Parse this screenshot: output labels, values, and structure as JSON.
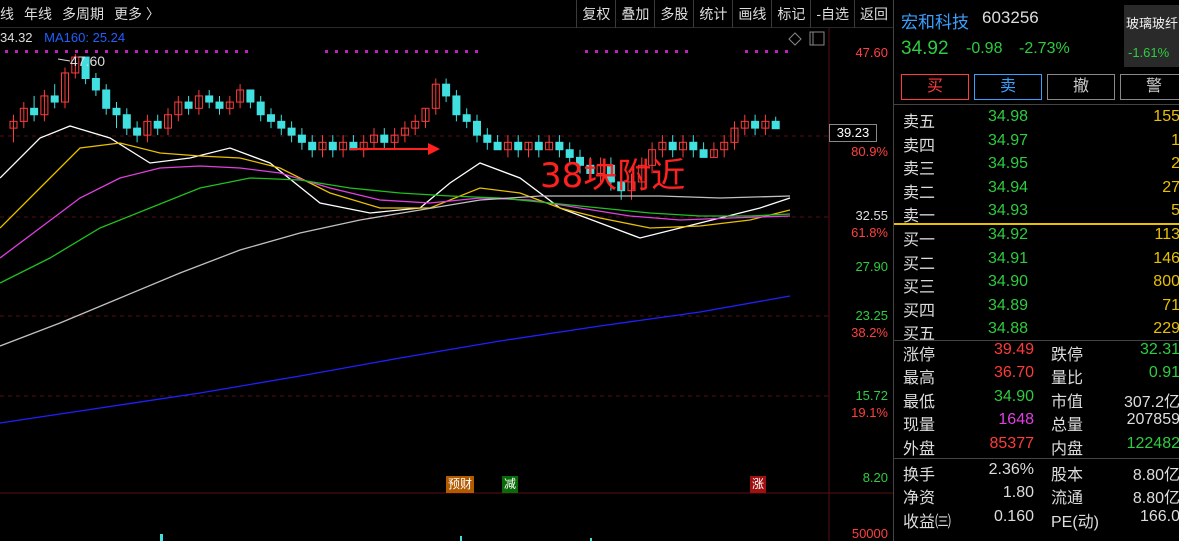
{
  "toolbar": {
    "left_items": [
      "线",
      "年线",
      "多周期",
      "更多 〉"
    ],
    "right_items": [
      "复权",
      "叠加",
      "多股",
      "统计",
      "画线",
      "标记",
      "-自选",
      "返回"
    ]
  },
  "legend": {
    "ma_partial": "34.32",
    "ma160": "MA160: 25.24"
  },
  "chart": {
    "peak_label": "47.60",
    "annotation": "38块附近",
    "current_price_box": "39.23",
    "price_labels": [
      "47.60",
      "32.55",
      "27.90",
      "23.25",
      "15.72",
      "8.20"
    ],
    "pct_labels": [
      "80.9%",
      "61.8%",
      "38.2%",
      "19.1%"
    ],
    "volume_label": "50000",
    "events": [
      {
        "label": "预财",
        "color": "#b25a00"
      },
      {
        "label": "减",
        "color": "#0a6a0a"
      },
      {
        "label": "涨",
        "color": "#a01010"
      }
    ]
  },
  "chart_data": {
    "type": "candlestick",
    "y_axis_ticks": [
      47.6,
      32.55,
      27.9,
      23.25,
      15.72,
      8.2
    ],
    "fib_levels": [
      {
        "label": "80.9%"
      },
      {
        "label": "61.8%"
      },
      {
        "label": "38.2%"
      },
      {
        "label": "19.1%"
      }
    ],
    "peak": 47.6,
    "current_price_marker": 39.23,
    "colors": {
      "up": "#ff3b3b",
      "down": "#40e0e0"
    },
    "ma_colors": [
      "#ffffff",
      "#e8c000",
      "#e040e0",
      "#20c020",
      "#c0c0c0",
      "#2020ff"
    ]
  },
  "panel": {
    "name": "宏和科技",
    "code": "603256",
    "price": "34.92",
    "change": "-0.98",
    "change_pct": "-2.73%",
    "sector_name": "玻璃玻纤",
    "sector_pct": "-1.61%",
    "buttons": [
      "买",
      "卖",
      "撤",
      "警"
    ],
    "asks": [
      {
        "label": "卖五",
        "price": "34.98",
        "vol": "155"
      },
      {
        "label": "卖四",
        "price": "34.97",
        "vol": "1"
      },
      {
        "label": "卖三",
        "price": "34.95",
        "vol": "2"
      },
      {
        "label": "卖二",
        "price": "34.94",
        "vol": "27"
      },
      {
        "label": "卖一",
        "price": "34.93",
        "vol": "5"
      }
    ],
    "bids": [
      {
        "label": "买一",
        "price": "34.92",
        "vol": "113"
      },
      {
        "label": "买二",
        "price": "34.91",
        "vol": "146"
      },
      {
        "label": "买三",
        "price": "34.90",
        "vol": "800"
      },
      {
        "label": "买四",
        "price": "34.89",
        "vol": "71"
      },
      {
        "label": "买五",
        "price": "34.88",
        "vol": "229"
      }
    ],
    "stats1": [
      {
        "k1": "涨停",
        "v1": "39.49",
        "c1": "red",
        "k2": "跌停",
        "v2": "32.31",
        "c2": "green"
      },
      {
        "k1": "最高",
        "v1": "36.70",
        "c1": "red",
        "k2": "量比",
        "v2": "0.91",
        "c2": "green"
      },
      {
        "k1": "最低",
        "v1": "34.90",
        "c1": "green",
        "k2": "市值",
        "v2": "307.2亿",
        "c2": "white"
      },
      {
        "k1": "现量",
        "v1": "1648",
        "c1": "magenta",
        "k2": "总量",
        "v2": "207859",
        "c2": "white"
      },
      {
        "k1": "外盘",
        "v1": "85377",
        "c1": "red",
        "k2": "内盘",
        "v2": "122482",
        "c2": "green"
      }
    ],
    "stats2": [
      {
        "k1": "换手",
        "v1": "2.36%",
        "c1": "white",
        "k2": "股本",
        "v2": "8.80亿",
        "c2": "white"
      },
      {
        "k1": "净资",
        "v1": "1.80",
        "c1": "white",
        "k2": "流通",
        "v2": "8.80亿",
        "c2": "white"
      },
      {
        "k1": "收益㈢",
        "v1": "0.160",
        "c1": "white",
        "k2": "PE(动)",
        "v2": "166.0",
        "c2": "white"
      }
    ]
  }
}
